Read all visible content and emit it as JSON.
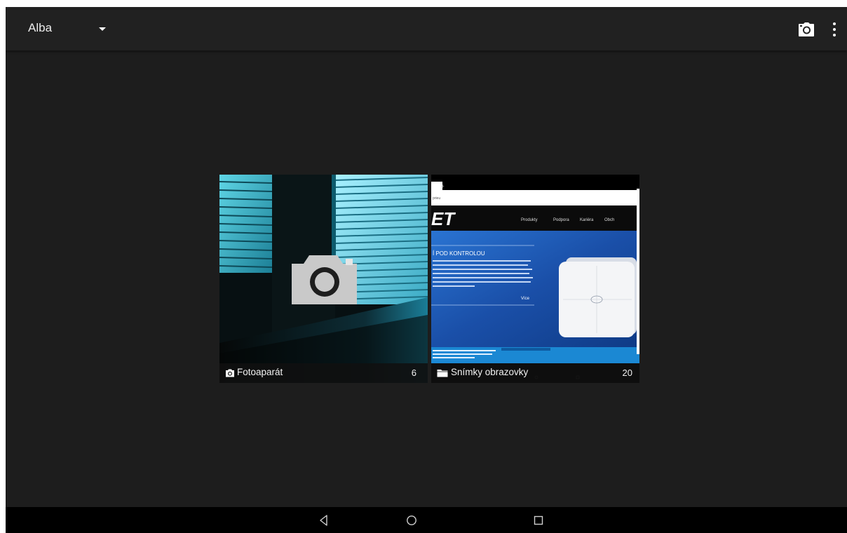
{
  "actionbar": {
    "title": "Alba",
    "dropdown_icon": "caret-down-icon",
    "camera_icon": "camera-icon",
    "overflow_icon": "more-vert-icon"
  },
  "albums": [
    {
      "label": "Fotoaparát",
      "count": "6",
      "icon": "camera-icon"
    },
    {
      "label": "Snímky obrazovky",
      "count": "20",
      "icon": "folder-icon"
    }
  ],
  "navbar": {
    "back_icon": "back-triangle-icon",
    "home_icon": "home-circle-icon",
    "recents_icon": "recents-square-icon"
  },
  "colors": {
    "background": "#1d1d1d",
    "actionbar": "#212121",
    "navbar": "#000000",
    "text": "#ececec"
  }
}
